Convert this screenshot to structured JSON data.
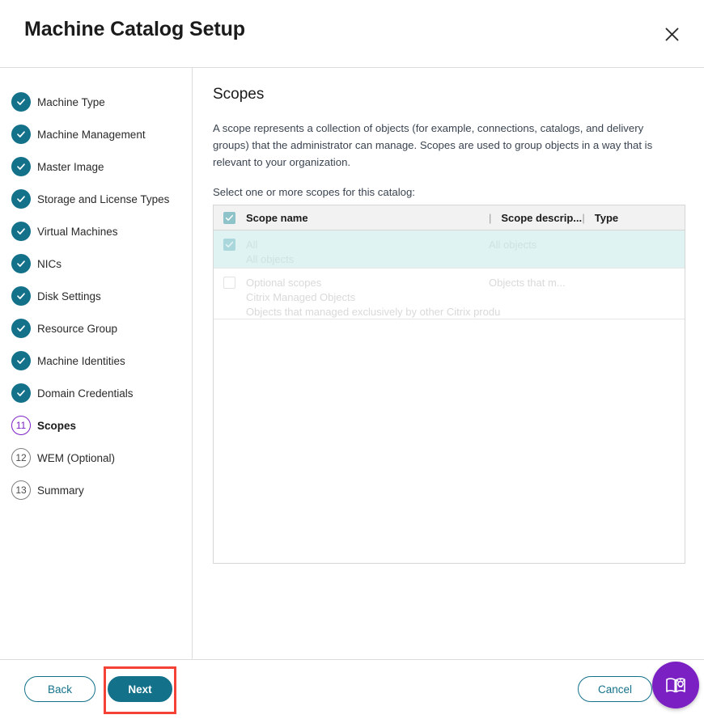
{
  "window": {
    "title": "Machine Catalog Setup",
    "close_icon": "close-icon"
  },
  "sidebar": {
    "steps": [
      {
        "number": "1",
        "label": "Machine Type",
        "state": "done"
      },
      {
        "number": "2",
        "label": "Machine Management",
        "state": "done"
      },
      {
        "number": "3",
        "label": "Master Image",
        "state": "done"
      },
      {
        "number": "4",
        "label": "Storage and License Types",
        "state": "done"
      },
      {
        "number": "5",
        "label": "Virtual Machines",
        "state": "done"
      },
      {
        "number": "6",
        "label": "NICs",
        "state": "done"
      },
      {
        "number": "7",
        "label": "Disk Settings",
        "state": "done"
      },
      {
        "number": "8",
        "label": "Resource Group",
        "state": "done"
      },
      {
        "number": "9",
        "label": "Machine Identities",
        "state": "done"
      },
      {
        "number": "10",
        "label": "Domain Credentials",
        "state": "done"
      },
      {
        "number": "11",
        "label": "Scopes",
        "state": "current"
      },
      {
        "number": "12",
        "label": "WEM (Optional)",
        "state": "pending"
      },
      {
        "number": "13",
        "label": "Summary",
        "state": "pending"
      }
    ]
  },
  "main": {
    "title": "Scopes",
    "description": "A scope represents a collection of objects (for example, connections, catalogs, and delivery groups) that the administrator can manage. Scopes are used to group objects in a way that is relevant to your organization.",
    "select_prompt": "Select one or more scopes for this catalog:",
    "table": {
      "columns": {
        "name": "Scope name",
        "description": "Scope descrip...",
        "type": "Type",
        "divider": "|"
      },
      "header_checkbox_checked": true,
      "rows": [
        {
          "checked": true,
          "selected": true,
          "name": "All",
          "subtitle": "All objects",
          "detail": "",
          "description": "All objects",
          "type": ""
        },
        {
          "checked": false,
          "selected": false,
          "name": "Optional scopes",
          "subtitle": "Citrix Managed Objects",
          "detail": "Objects that managed exclusively by other Citrix produ",
          "description": "Objects that m...",
          "type": ""
        }
      ]
    }
  },
  "footer": {
    "back_label": "Back",
    "next_label": "Next",
    "cancel_label": "Cancel",
    "help_icon": "book-lightbulb-icon"
  },
  "colors": {
    "accent_teal": "#13718a",
    "accent_purple": "#7b21c4",
    "highlight_red": "#f44336",
    "row_selected": "#dff3f2",
    "header_grey": "#f2f2f2"
  }
}
